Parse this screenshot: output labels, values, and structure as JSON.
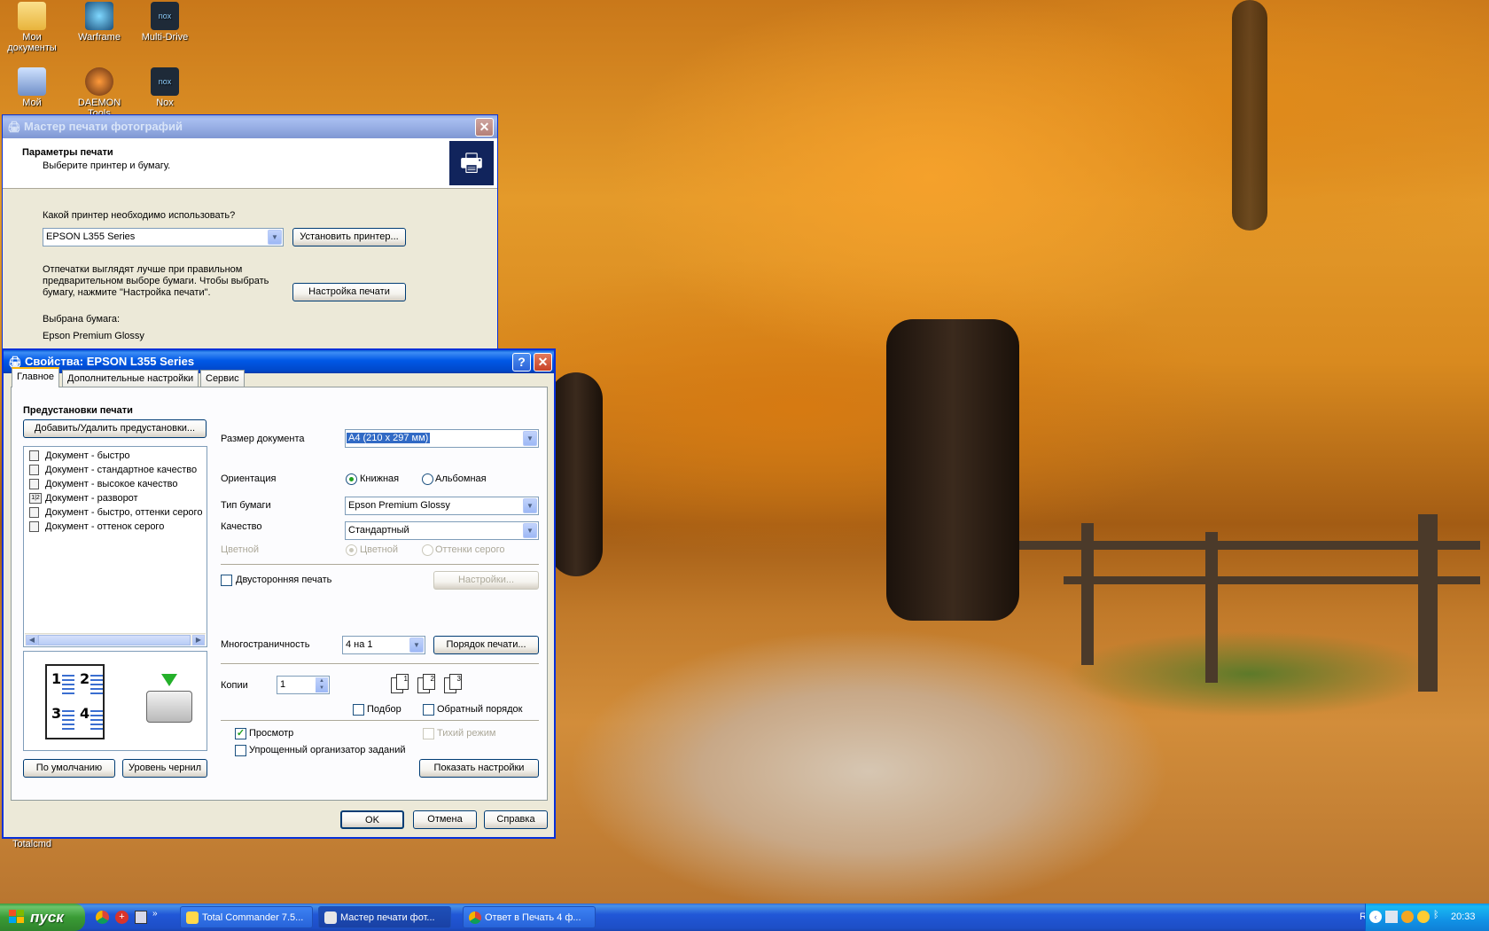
{
  "desktop_icons": [
    {
      "label": "Мои документы",
      "icon": "folder-documents-icon"
    },
    {
      "label": "Warframe",
      "icon": "warframe-icon"
    },
    {
      "label": "Multi-Drive",
      "icon": "nox-icon"
    },
    {
      "label": "Мой",
      "icon": "my-computer-icon"
    },
    {
      "label": "DAEMON Tools",
      "icon": "daemon-tools-icon"
    },
    {
      "label": "Nox",
      "icon": "nox-icon"
    },
    {
      "label": "Totalcmd",
      "icon": "total-commander-icon"
    }
  ],
  "wizard": {
    "title": "Мастер печати фотографий",
    "header_title": "Параметры печати",
    "header_subtitle": "Выберите принтер и бумагу.",
    "printer_question": "Какой принтер необходимо использовать?",
    "printer_value": "EPSON L355 Series",
    "install_printer_button": "Установить принтер...",
    "paper_hint_1": "Отпечатки выглядят лучше при правильном",
    "paper_hint_2": "предварительном выборе бумаги. Чтобы выбрать",
    "paper_hint_3": "бумагу, нажмите \"Настройка печати\".",
    "print_setup_button": "Настройка печати",
    "selected_paper_label": "Выбрана бумага:",
    "selected_paper_value": "Epson Premium Glossy"
  },
  "props": {
    "title": "Свойства: EPSON L355 Series",
    "tabs": [
      "Главное",
      "Дополнительные настройки",
      "Сервис"
    ],
    "presets_heading": "Предустановки печати",
    "add_remove_button": "Добавить/Удалить предустановки...",
    "presets": [
      "Документ - быстро",
      "Документ - стандартное качество",
      "Документ - высокое качество",
      "Документ - разворот",
      "Документ - быстро, оттенки серого",
      "Документ - оттенок серого"
    ],
    "preview_page_numbers": [
      "1",
      "2",
      "3",
      "4"
    ],
    "default_button": "По умолчанию",
    "ink_levels_button": "Уровень чернил",
    "doc_size_label": "Размер документа",
    "doc_size_value": "A4 (210 x 297 мм)",
    "orientation_label": "Ориентация",
    "portrait_label": "Книжная",
    "landscape_label": "Альбомная",
    "paper_type_label": "Тип бумаги",
    "paper_type_value": "Epson Premium Glossy",
    "quality_label": "Качество",
    "quality_value": "Стандартный",
    "color_label": "Цветной",
    "color_option": "Цветной",
    "grayscale_option": "Оттенки серого",
    "duplex_label": "Двусторонняя печать",
    "duplex_settings_button": "Настройки...",
    "multipage_label": "Многостраничность",
    "multipage_value": "4 на 1",
    "print_order_button": "Порядок печати...",
    "copies_label": "Копии",
    "copies_value": "1",
    "collate_label": "Подбор",
    "reverse_order_label": "Обратный порядок",
    "preview_label": "Просмотр",
    "quiet_mode_label": "Тихий режим",
    "job_arranger_label": "Упрощенный организатор заданий",
    "show_settings_button": "Показать настройки",
    "ok_button": "OK",
    "cancel_button": "Отмена",
    "help_button": "Справка"
  },
  "taskbar": {
    "start_label": "пуск",
    "tasks": [
      "Total Commander 7.5...",
      "Мастер печати фот...",
      "Ответ в Печать 4 ф..."
    ],
    "language": "RU",
    "clock": "20:33"
  }
}
